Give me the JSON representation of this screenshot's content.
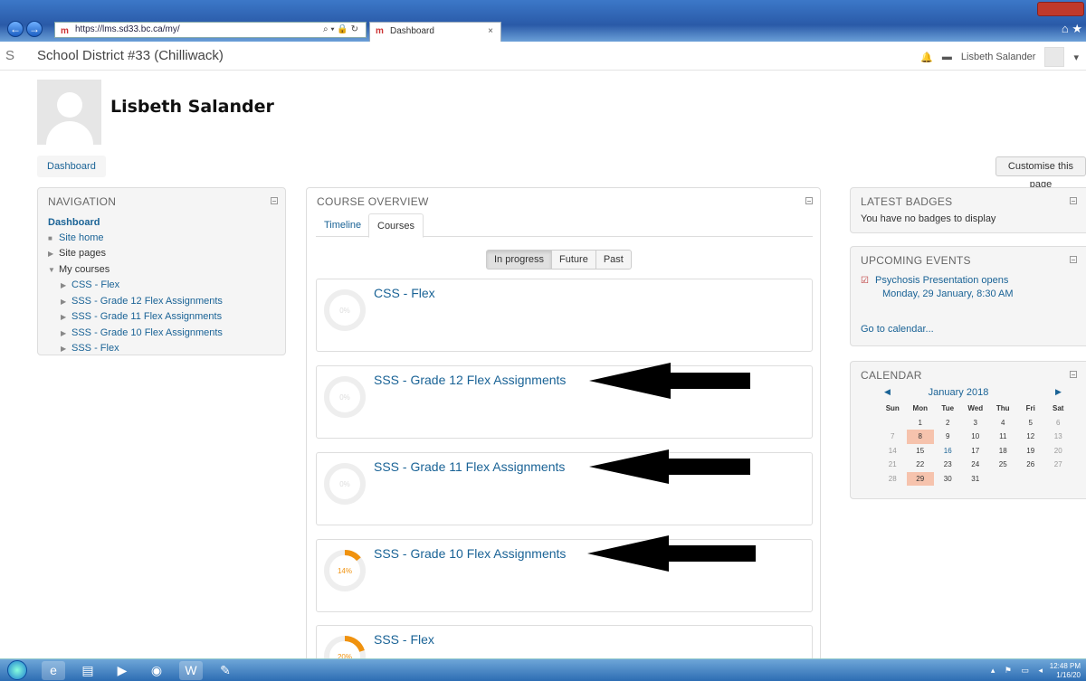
{
  "browser": {
    "url": "https://lms.sd33.bc.ca/my/",
    "tab_title": "Dashboard",
    "address_tools": "⌕ ▾ 🔒 ↻",
    "fav_glyph": "m"
  },
  "header": {
    "site_name": "School District #33 (Chilliwack)",
    "user_name": "Lisbeth Salander"
  },
  "profile": {
    "full_name": "Lisbeth Salander"
  },
  "breadcrumb": {
    "item": "Dashboard"
  },
  "customise_button": "Customise this page",
  "navigation": {
    "title": "NAVIGATION",
    "dashboard": "Dashboard",
    "site_home": "Site home",
    "site_pages": "Site pages",
    "my_courses": "My courses",
    "courses": [
      "CSS - Flex",
      "SSS - Grade 12 Flex Assignments",
      "SSS - Grade 11 Flex Assignments",
      "SSS - Grade 10 Flex Assignments",
      "SSS - Flex"
    ]
  },
  "course_overview": {
    "title": "COURSE OVERVIEW",
    "tabs": [
      "Timeline",
      "Courses"
    ],
    "filters": [
      "In progress",
      "Future",
      "Past"
    ],
    "courses": [
      {
        "name": "CSS - Flex",
        "progress_label": "0%",
        "progress": 0
      },
      {
        "name": "SSS - Grade 12 Flex Assignments",
        "progress_label": "0%",
        "progress": 0
      },
      {
        "name": "SSS - Grade 11 Flex Assignments",
        "progress_label": "0%",
        "progress": 0
      },
      {
        "name": "SSS - Grade 10 Flex Assignments",
        "progress_label": "14%",
        "progress": 14
      },
      {
        "name": "SSS - Flex",
        "progress_label": "20%",
        "progress": 20
      }
    ]
  },
  "badges": {
    "title": "LATEST BADGES",
    "message": "You have no badges to display"
  },
  "events": {
    "title": "UPCOMING EVENTS",
    "event_name": "Psychosis Presentation opens",
    "event_date": "Monday, 29 January, 8:30 AM",
    "calendar_link": "Go to calendar..."
  },
  "calendar": {
    "title": "CALENDAR",
    "month": "January 2018",
    "days": [
      "Sun",
      "Mon",
      "Tue",
      "Wed",
      "Thu",
      "Fri",
      "Sat"
    ],
    "weeks": [
      [
        "",
        "1",
        "2",
        "3",
        "4",
        "5",
        "6"
      ],
      [
        "7",
        "8",
        "9",
        "10",
        "11",
        "12",
        "13"
      ],
      [
        "14",
        "15",
        "16",
        "17",
        "18",
        "19",
        "20"
      ],
      [
        "21",
        "22",
        "23",
        "24",
        "25",
        "26",
        "27"
      ],
      [
        "28",
        "29",
        "30",
        "31",
        "",
        "",
        ""
      ]
    ]
  },
  "taskbar": {
    "time": "12:48 PM",
    "date": "1/16/20"
  },
  "colors": {
    "link": "#1a6396",
    "progress": "#f0920e",
    "highlight": "#f6c3ad"
  }
}
